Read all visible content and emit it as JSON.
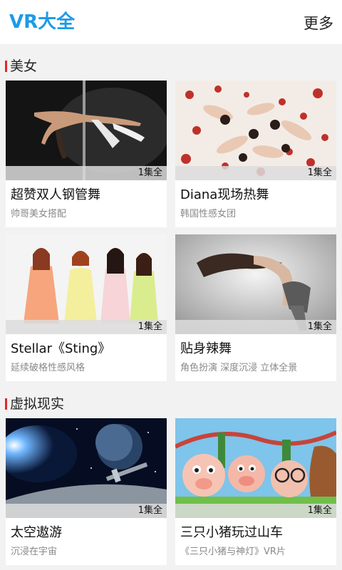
{
  "header": {
    "title": "VR大全",
    "more_label": "更多"
  },
  "colors": {
    "accent": "#1e9be6",
    "section_marker": "#e2272b"
  },
  "sections": [
    {
      "title": "美女",
      "cards": [
        {
          "title": "超赞双人钢管舞",
          "subtitle": "帅哥美女搭配",
          "episodes": "1集全"
        },
        {
          "title": "Diana现场热舞",
          "subtitle": "韩国性感女团",
          "episodes": "1集全"
        },
        {
          "title": "Stellar《Sting》",
          "subtitle": "延续破格性感风格",
          "episodes": "1集全"
        },
        {
          "title": "贴身辣舞",
          "subtitle": "角色扮演 深度沉浸 立体全景",
          "episodes": "1集全"
        }
      ]
    },
    {
      "title": "虚拟现实",
      "cards": [
        {
          "title": "太空遨游",
          "subtitle": "沉浸在宇宙",
          "episodes": "1集全"
        },
        {
          "title": "三只小猪玩过山车",
          "subtitle": "《三只小猪与神灯》VR片",
          "episodes": "1集全"
        }
      ]
    }
  ]
}
